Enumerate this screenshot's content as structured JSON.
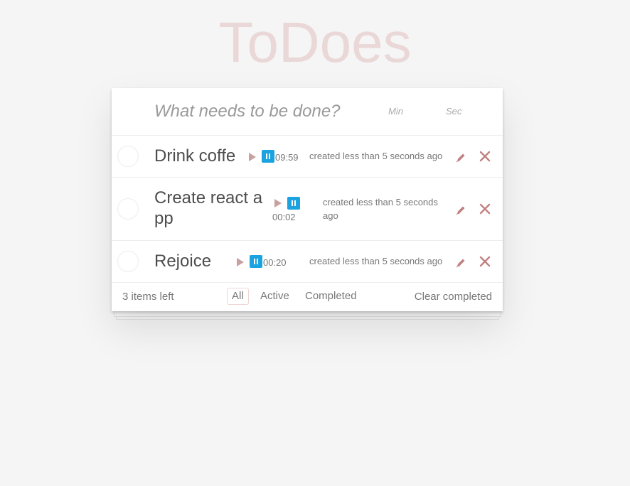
{
  "app": {
    "title": "ToDoes"
  },
  "header": {
    "new_todo_placeholder": "What needs to be done?",
    "min_placeholder": "Min",
    "sec_placeholder": "Sec"
  },
  "todos": [
    {
      "title": "Drink coffe",
      "timer": "09:59",
      "created": "created less than 5 seconds ago",
      "completed": false
    },
    {
      "title_line1": "Create react a",
      "title_line2": "pp",
      "timer": "00:02",
      "created_line1": "created less than 5 seconds",
      "created_line2": "ago",
      "completed": false
    },
    {
      "title": "Rejoice",
      "timer": "00:20",
      "created": "created less than 5 seconds ago",
      "completed": false
    }
  ],
  "footer": {
    "items_left": "3 items left",
    "filters": [
      "All",
      "Active",
      "Completed"
    ],
    "selected_filter": "All",
    "clear_completed": "Clear completed"
  },
  "colors": {
    "title": "#efd5d5",
    "pause_button": "#1aa3e0",
    "play_icon": "#c9a0a0",
    "edit_icon": "#c08080",
    "destroy_icon": "#c08080"
  },
  "icons": [
    "play-icon",
    "pause-icon",
    "pencil-icon",
    "close-icon"
  ]
}
